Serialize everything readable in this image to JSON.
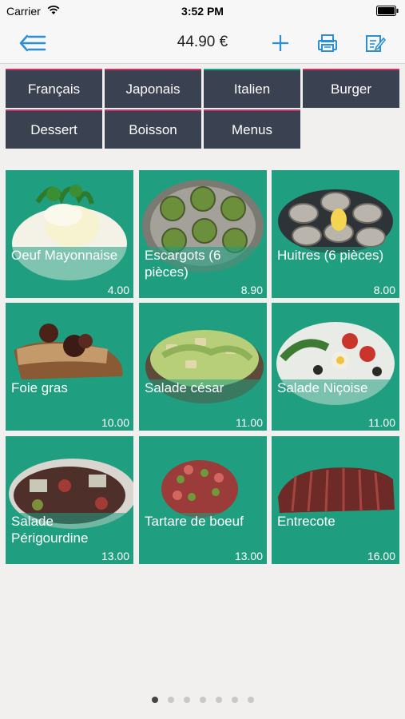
{
  "status_bar": {
    "carrier": "Carrier",
    "time": "3:52 PM"
  },
  "navbar": {
    "total": "44.90 €"
  },
  "categories": [
    {
      "label": "Français",
      "accent": "#cc3366"
    },
    {
      "label": "Japonais",
      "accent": "#cc3366"
    },
    {
      "label": "Italien",
      "accent": "#1aa583"
    },
    {
      "label": "Burger",
      "accent": "#cc3366"
    },
    {
      "label": "Dessert",
      "accent": "#cc3366"
    },
    {
      "label": "Boisson",
      "accent": "#cc3366"
    },
    {
      "label": "Menus",
      "accent": "#cc3366"
    }
  ],
  "dishes": [
    {
      "name": "Oeuf Mayonnaise",
      "price": "4.00",
      "icon": "egg-mayonnaise-image"
    },
    {
      "name": "Escargots (6 pièces)",
      "price": "8.90",
      "icon": "escargots-image"
    },
    {
      "name": "Huitres (6 pièces)",
      "price": "8.00",
      "icon": "oysters-image"
    },
    {
      "name": "Foie gras",
      "price": "10.00",
      "icon": "foie-gras-image"
    },
    {
      "name": "Salade césar",
      "price": "11.00",
      "icon": "caesar-salad-image"
    },
    {
      "name": "Salade Niçoise",
      "price": "11.00",
      "icon": "nicoise-salad-image"
    },
    {
      "name": "Salade Périgourdine",
      "price": "13.00",
      "icon": "perigourdine-salad-image"
    },
    {
      "name": "Tartare de boeuf",
      "price": "13.00",
      "icon": "beef-tartare-image"
    },
    {
      "name": "Entrecote",
      "price": "16.00",
      "icon": "entrecote-image"
    }
  ],
  "pager": {
    "pages": 7,
    "active": 1
  },
  "colors": {
    "tile": "#1f9f7f",
    "category": "#3a4150",
    "accent_blue": "#2a8fd6"
  }
}
